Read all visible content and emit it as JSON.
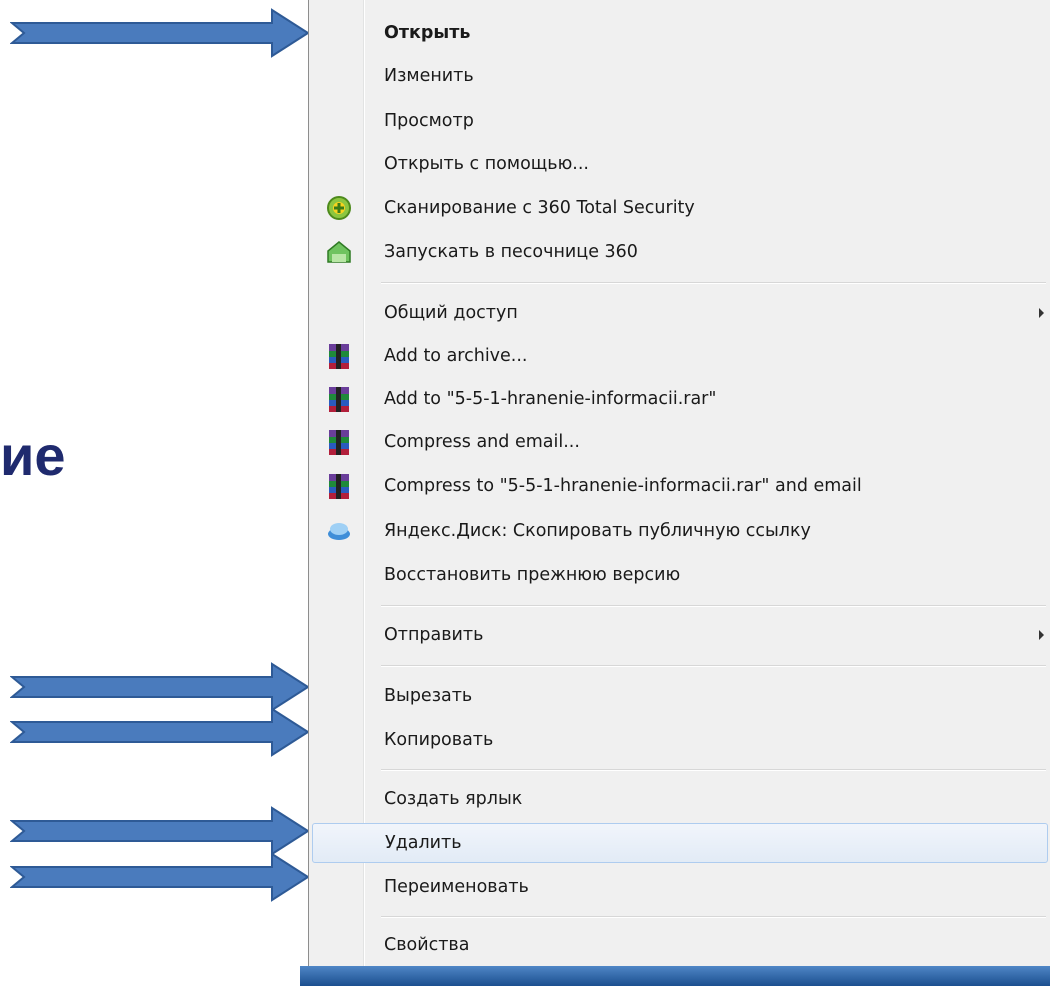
{
  "slide": {
    "partial_heading": "ие",
    "heading_color": "#1f2a6e",
    "arrow_color": "#4a7bbd"
  },
  "menu": {
    "highlight_color": "#e2ebf6",
    "items": [
      {
        "label": "Открыть",
        "bold": true
      },
      {
        "label": "Изменить"
      },
      {
        "label": "Просмотр"
      },
      {
        "label": "Открыть с помощью..."
      },
      {
        "label": "Сканирование с 360 Total Security",
        "icon": "360-scan-icon"
      },
      {
        "label": "Запускать в песочнице 360",
        "icon": "360-sandbox-icon"
      },
      {
        "label": "Общий доступ",
        "submenu": true
      },
      {
        "label": "Add to archive...",
        "icon": "winrar-icon"
      },
      {
        "label": "Add to \"5-5-1-hranenie-informacii.rar\"",
        "icon": "winrar-icon"
      },
      {
        "label": "Compress and email...",
        "icon": "winrar-icon"
      },
      {
        "label": "Compress to \"5-5-1-hranenie-informacii.rar\" and email",
        "icon": "winrar-icon"
      },
      {
        "label": "Яндекс.Диск: Скопировать публичную ссылку",
        "icon": "yandex-disk-icon"
      },
      {
        "label": "Восстановить прежнюю версию"
      },
      {
        "label": "Отправить",
        "submenu": true
      },
      {
        "label": "Вырезать"
      },
      {
        "label": "Копировать"
      },
      {
        "label": "Создать ярлык"
      },
      {
        "label": "Удалить",
        "highlighted": true
      },
      {
        "label": "Переименовать"
      },
      {
        "label": "Свойства"
      }
    ]
  }
}
